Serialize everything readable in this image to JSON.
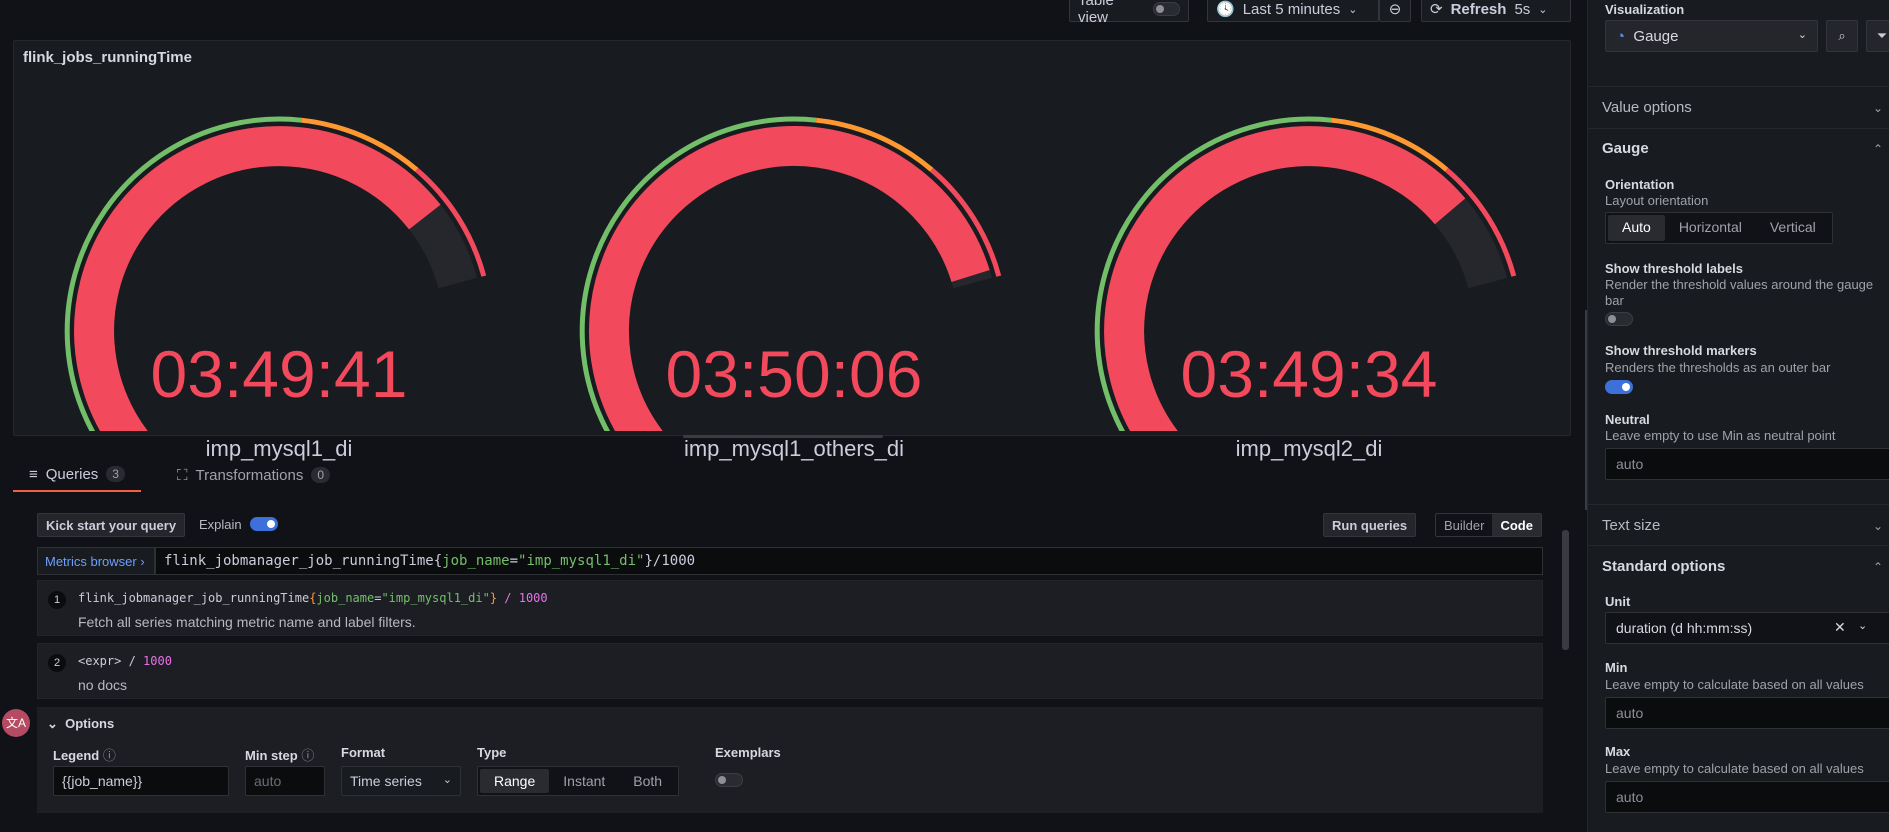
{
  "toolbar": {
    "table_view_label": "Table view",
    "time_range": "Last 5 minutes",
    "refresh_label": "Refresh",
    "refresh_interval": "5s"
  },
  "panel": {
    "title": "flink_jobs_runningTime",
    "gauges": [
      {
        "value": "03:49:41",
        "label": "imp_mysql1_di",
        "fill": 0.9
      },
      {
        "value": "03:50:06",
        "label": "imp_mysql1_others_di",
        "fill": 0.99
      },
      {
        "value": "03:49:34",
        "label": "imp_mysql2_di",
        "fill": 0.89
      }
    ]
  },
  "query_tabs": [
    {
      "label": "Queries",
      "count": "3"
    },
    {
      "label": "Transformations",
      "count": "0"
    }
  ],
  "query": {
    "kick_start": "Kick start your query",
    "explain_label": "Explain",
    "run_queries": "Run queries",
    "mode_builder": "Builder",
    "mode_code": "Code",
    "metrics_browser": "Metrics browser ›",
    "expr_metric": "flink_jobmanager_job_runningTime",
    "expr_label_key": "job_name",
    "expr_label_value": "\"imp_mysql1_di\"",
    "expr_suffix": "/1000",
    "suggestions": [
      {
        "num": "1",
        "doc": "Fetch all series matching metric name and label filters.",
        "spaced_suffix": " / 1000"
      },
      {
        "num": "2",
        "expr": "<expr>",
        "op": " / ",
        "n": "1000",
        "doc": "no docs"
      }
    ],
    "options": {
      "title": "Options",
      "legend_label": "Legend",
      "legend_value": "{{job_name}}",
      "minstep_label": "Min step",
      "minstep_placeholder": "auto",
      "format_label": "Format",
      "format_value": "Time series",
      "type_label": "Type",
      "type_options": [
        "Range",
        "Instant",
        "Both"
      ],
      "exemplars_label": "Exemplars"
    }
  },
  "pane": {
    "visualization_label": "Visualization",
    "visualization_value": "Gauge",
    "value_options": "Value options",
    "gauge_section": "Gauge",
    "orientation_label": "Orientation",
    "orientation_desc": "Layout orientation",
    "orientation_options": [
      "Auto",
      "Horizontal",
      "Vertical"
    ],
    "threshold_labels_label": "Show threshold labels",
    "threshold_labels_desc": "Render the threshold values around the gauge bar",
    "threshold_markers_label": "Show threshold markers",
    "threshold_markers_desc": "Renders the thresholds as an outer bar",
    "neutral_label": "Neutral",
    "neutral_desc": "Leave empty to use Min as neutral point",
    "neutral_placeholder": "auto",
    "text_size": "Text size",
    "standard_options": "Standard options",
    "unit_label": "Unit",
    "unit_value": "duration (d hh:mm:ss)",
    "min_label": "Min",
    "min_desc": "Leave empty to calculate based on all values",
    "min_placeholder": "auto",
    "max_label": "Max",
    "max_desc": "Leave empty to calculate based on all values",
    "max_placeholder": "auto"
  },
  "colors": {
    "red": "#f2495c",
    "green": "#73bf69",
    "orange": "#ff9830",
    "blue": "#3d71d9",
    "track": "#25272d"
  }
}
